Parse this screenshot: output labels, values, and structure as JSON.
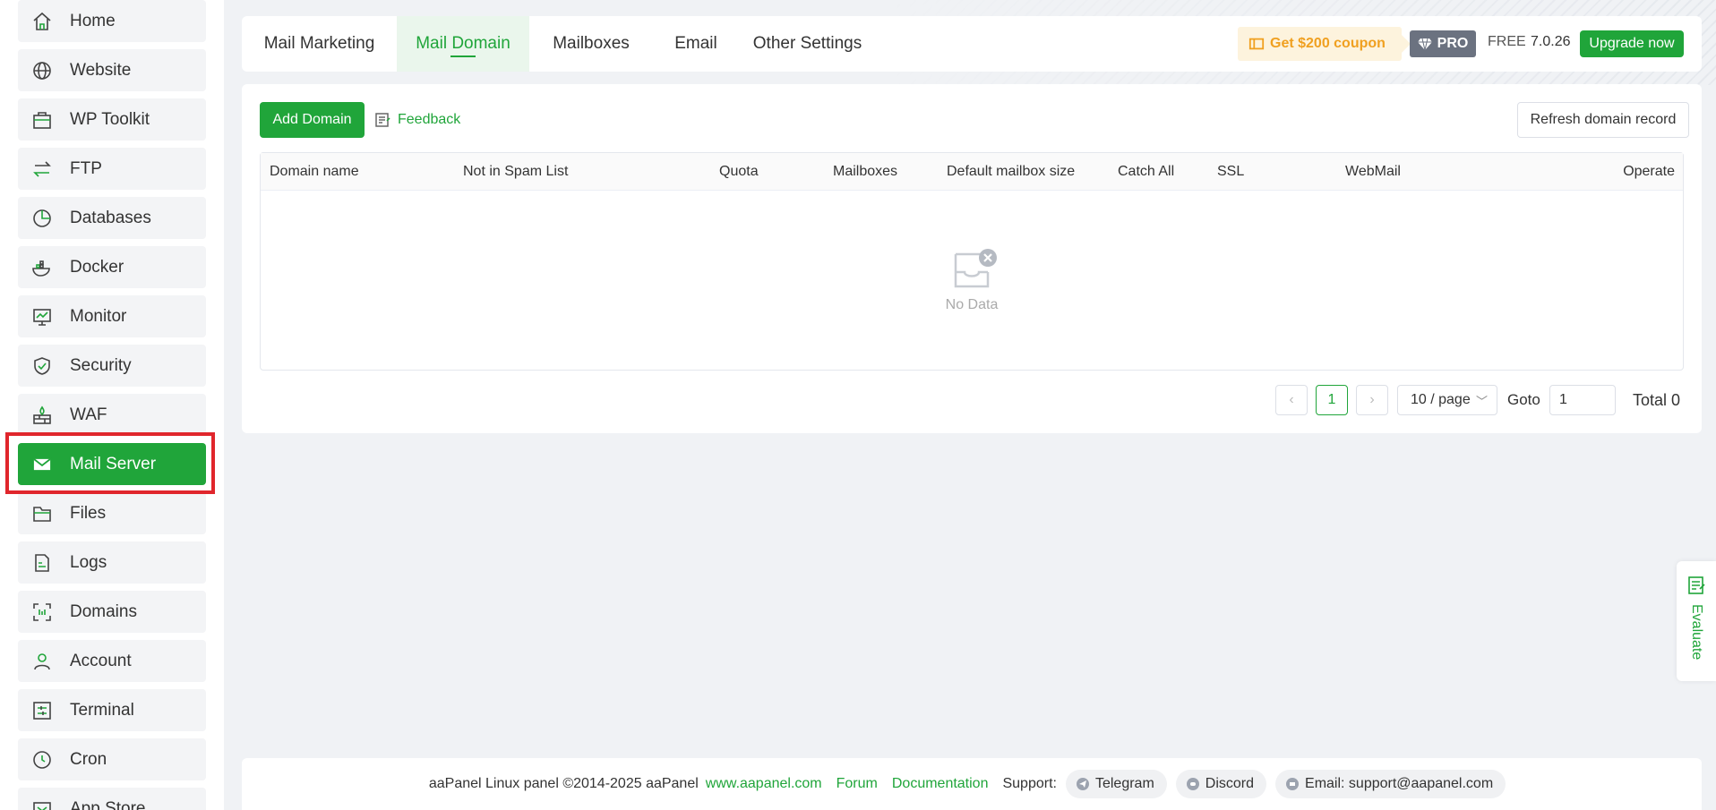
{
  "sidebar": {
    "items": [
      {
        "label": "Home",
        "icon": "home-icon"
      },
      {
        "label": "Website",
        "icon": "globe-icon"
      },
      {
        "label": "WP Toolkit",
        "icon": "toolkit-icon"
      },
      {
        "label": "FTP",
        "icon": "transfer-icon"
      },
      {
        "label": "Databases",
        "icon": "database-icon"
      },
      {
        "label": "Docker",
        "icon": "docker-icon"
      },
      {
        "label": "Monitor",
        "icon": "monitor-icon"
      },
      {
        "label": "Security",
        "icon": "shield-icon"
      },
      {
        "label": "WAF",
        "icon": "firewall-icon"
      },
      {
        "label": "Mail Server",
        "icon": "mail-icon",
        "active": true
      },
      {
        "label": "Files",
        "icon": "folder-icon"
      },
      {
        "label": "Logs",
        "icon": "log-icon"
      },
      {
        "label": "Domains",
        "icon": "domains-icon"
      },
      {
        "label": "Account",
        "icon": "user-icon"
      },
      {
        "label": "Terminal",
        "icon": "terminal-icon"
      },
      {
        "label": "Cron",
        "icon": "clock-icon"
      },
      {
        "label": "App Store",
        "icon": "store-icon"
      }
    ]
  },
  "tabs": [
    {
      "label": "Mail Marketing"
    },
    {
      "label": "Mail Domain",
      "active": true
    },
    {
      "label": "Mailboxes"
    },
    {
      "label": "Email"
    },
    {
      "label": "Other Settings"
    }
  ],
  "header": {
    "coupon_label": "Get $200 coupon",
    "pro_label": "PRO",
    "free_label": "FREE",
    "version": "7.0.26",
    "upgrade_label": "Upgrade now"
  },
  "toolbar": {
    "add_domain_label": "Add Domain",
    "feedback_label": "Feedback",
    "refresh_label": "Refresh domain record"
  },
  "table": {
    "columns": [
      "Domain name",
      "Not in Spam List",
      "Quota",
      "Mailboxes",
      "Default mailbox size",
      "Catch All",
      "SSL",
      "WebMail",
      "Operate"
    ],
    "empty_text": "No Data"
  },
  "pagination": {
    "current_page": "1",
    "page_size": "10 / page",
    "goto_label": "Goto",
    "goto_value": "1",
    "total_label": "Total 0"
  },
  "footer": {
    "copyright": "aaPanel Linux panel ©2014-2025 aaPanel",
    "website_link": "www.aapanel.com",
    "forum_link": "Forum",
    "docs_link": "Documentation",
    "support_label": "Support:",
    "telegram": "Telegram",
    "discord": "Discord",
    "email": "Email: support@aapanel.com"
  },
  "evaluate_label": "Evaluate",
  "colors": {
    "accent": "#20a53a",
    "coupon": "#f0a020",
    "highlight": "#e0262c"
  }
}
